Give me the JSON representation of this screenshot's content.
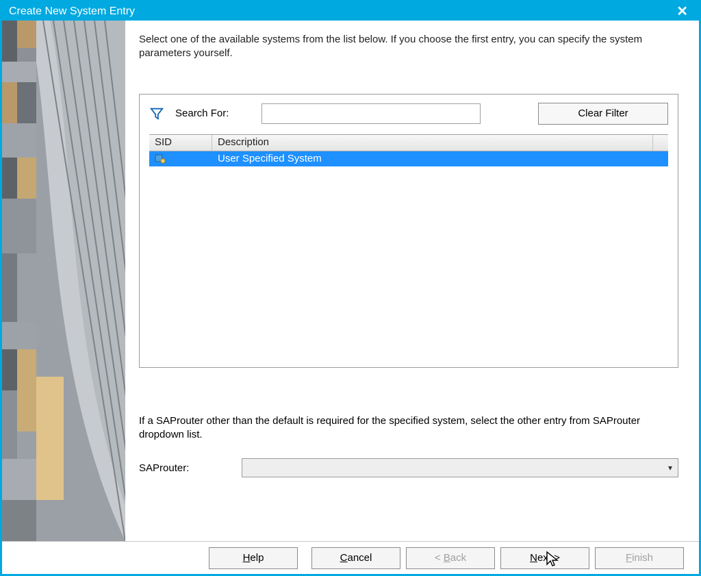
{
  "window": {
    "title": "Create New System Entry"
  },
  "instruction": "Select one of the available systems from the list below. If you choose the first entry, you can specify the system parameters yourself.",
  "search": {
    "label": "Search For:",
    "value": "",
    "clear_label": "Clear Filter"
  },
  "table": {
    "columns": {
      "sid": "SID",
      "desc": "Description"
    },
    "rows": [
      {
        "sid": "",
        "desc": "User Specified System",
        "selected": true
      }
    ]
  },
  "router": {
    "note": "If a SAProuter other than the default is required for the specified system, select the other entry from SAProuter dropdown list.",
    "label": "SAProuter:",
    "value": ""
  },
  "buttons": {
    "help": "Help",
    "cancel": "Cancel",
    "back": "< Back",
    "next": "Next >",
    "finish": "Finish"
  }
}
